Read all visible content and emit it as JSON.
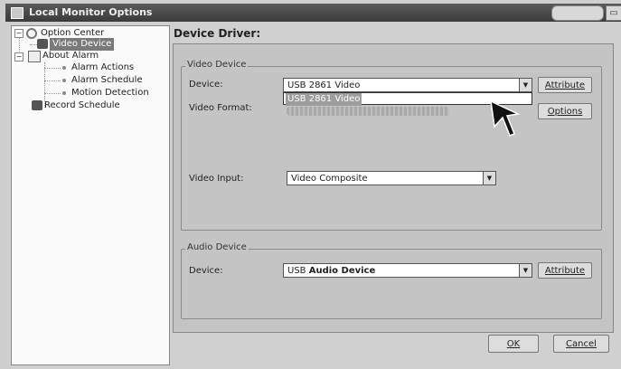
{
  "window": {
    "title": "Local Monitor Options"
  },
  "tree": {
    "root": "Option Center",
    "items": [
      {
        "label": "Video Device",
        "selected": true
      },
      {
        "label": "About Alarm"
      },
      {
        "label": "Alarm Actions"
      },
      {
        "label": "Alarm Schedule"
      },
      {
        "label": "Motion Detection"
      },
      {
        "label": "Record Schedule"
      }
    ]
  },
  "panel": {
    "title": "Device Driver:"
  },
  "video_device": {
    "group_label": "Video Device",
    "device_label": "Device:",
    "device_value": "USB 2861 Video",
    "dropdown_option": "USB 2861 Video",
    "attribute_button": "Attribute",
    "format_label": "Video Format:",
    "options_button": "Options",
    "input_label": "Video Input:",
    "input_value": "Video Composite"
  },
  "audio_device": {
    "group_label": "Audio Device",
    "device_label": "Device:",
    "device_value_prefix": "USB ",
    "device_value_bold": "Audio Device",
    "attribute_button": "Attribute"
  },
  "footer": {
    "ok": "OK",
    "cancel": "Cancel"
  }
}
